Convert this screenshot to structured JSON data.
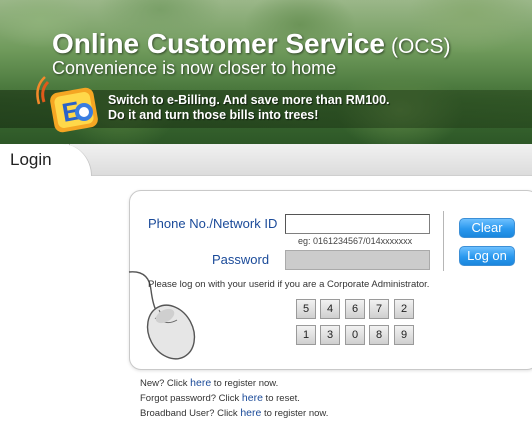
{
  "banner": {
    "title": "Online Customer Service",
    "title_abbr": "(OCS)",
    "subtitle": "Convenience is now closer to home",
    "promo_line1": "Switch to e-Billing. And save more than RM100.",
    "promo_line2": "Do it and turn those bills into trees!",
    "logo_icon": "e-billing-logo-icon"
  },
  "tab": {
    "label": "Login"
  },
  "form": {
    "phone_label": "Phone No./Network ID",
    "phone_value": "",
    "phone_hint": "eg: 0161234567/014xxxxxxx",
    "password_label": "Password",
    "password_value": "",
    "clear_label": "Clear",
    "logon_label": "Log on",
    "corporate_notice": "Please log on with your userid if you are a Corporate Administrator."
  },
  "keypad": {
    "row1": [
      "5",
      "4",
      "6",
      "7",
      "2"
    ],
    "row2": [
      "1",
      "3",
      "0",
      "8",
      "9"
    ]
  },
  "links": {
    "new_prefix": "New? Click ",
    "new_link": "here",
    "new_suffix": " to register now.",
    "forgot_prefix": "Forgot password? Click ",
    "forgot_link": "here",
    "forgot_suffix": " to reset.",
    "broadband_prefix": "Broadband User? Click ",
    "broadband_link": "here",
    "broadband_suffix": " to register now."
  },
  "colors": {
    "label_blue": "#1a4a99",
    "button_blue": "#2a98ee",
    "banner_green": "#3f6e34"
  }
}
